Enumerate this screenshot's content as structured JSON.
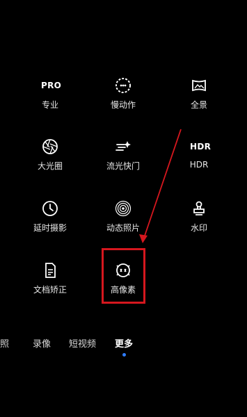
{
  "grid": {
    "pro": {
      "icon_text": "PRO",
      "label": "专业"
    },
    "slowmo": {
      "label": "慢动作"
    },
    "panorama": {
      "label": "全景"
    },
    "aperture": {
      "label": "大光圈"
    },
    "light_painting": {
      "label": "流光快门"
    },
    "hdr": {
      "icon_text": "HDR",
      "label": "HDR"
    },
    "timelapse": {
      "label": "延时摄影"
    },
    "moving_picture": {
      "label": "动态照片"
    },
    "watermark": {
      "label": "水印"
    },
    "document": {
      "label": "文档矫正"
    },
    "high_res": {
      "label": "高像素"
    }
  },
  "modes": {
    "photo": "拍照",
    "video": "录像",
    "short_video": "短视频",
    "more": "更多",
    "active": "更多"
  },
  "colors": {
    "background": "#000000",
    "annotation_red": "#d6171e",
    "active_dot": "#2f7dff"
  }
}
